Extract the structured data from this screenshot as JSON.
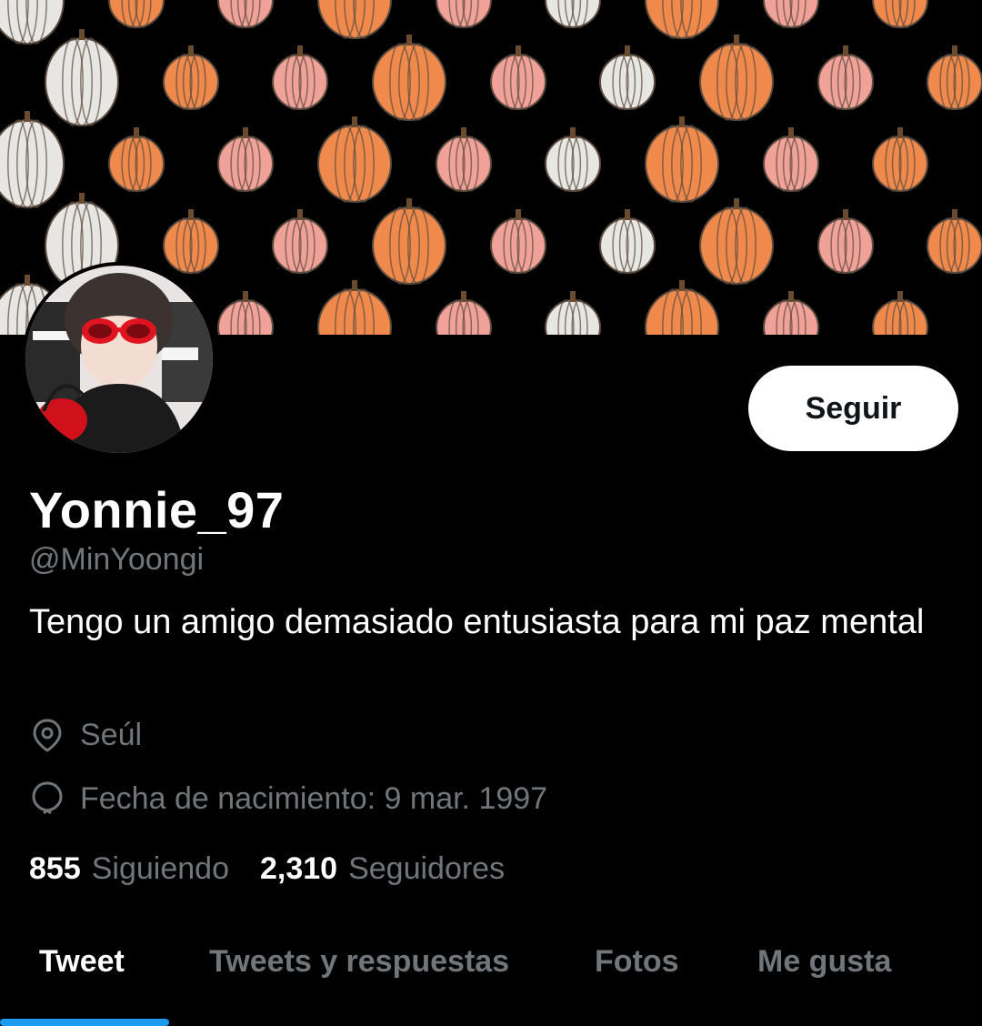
{
  "profile": {
    "display_name": "Yonnie_97",
    "handle": "@MinYoongi",
    "bio": "Tengo un amigo demasiado entusiasta para mi paz mental",
    "location": "Seúl",
    "birthdate": "Fecha de nacimiento: 9 mar. 1997"
  },
  "actions": {
    "follow_label": "Seguir"
  },
  "stats": {
    "following_count": "855",
    "following_label": "Siguiendo",
    "followers_count": "2,310",
    "followers_label": "Seguidores"
  },
  "tabs": [
    {
      "label": "Tweet",
      "active": true
    },
    {
      "label": "Tweets y respuestas",
      "active": false
    },
    {
      "label": "Fotos",
      "active": false
    },
    {
      "label": "Me gusta",
      "active": false
    }
  ],
  "icons": {
    "location": "location-pin-icon",
    "birthday": "balloon-icon"
  },
  "colors": {
    "background": "#000000",
    "accent": "#1d9bf0",
    "secondary_text": "#71767b",
    "pumpkin_orange": "#ef8a4c",
    "pumpkin_pink": "#f0a198",
    "pumpkin_white": "#e8e6e3"
  }
}
